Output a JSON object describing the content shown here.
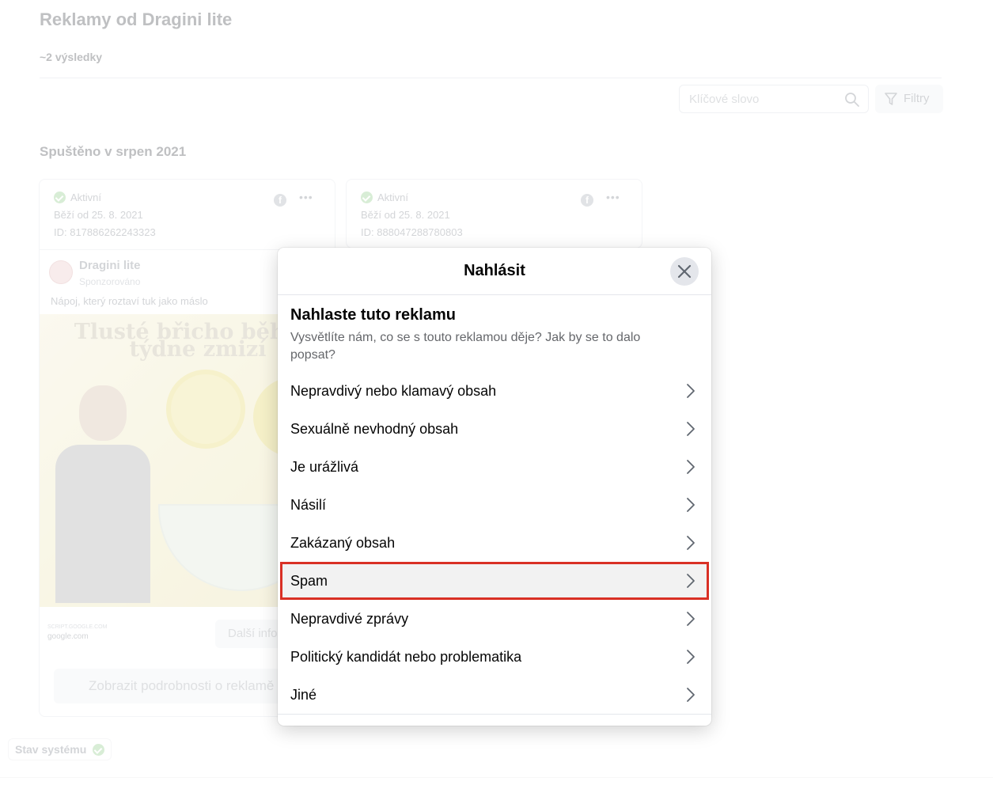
{
  "background": {
    "page_title": "Reklamy od Dragini lite",
    "result_count": "~2 výsledky",
    "search_placeholder": "Klíčové slovo",
    "filter_label": "Filtry",
    "section_title": "Spuštěno v srpen 2021",
    "cards": [
      {
        "status": "Aktivní",
        "running_since": "Běží od 25. 8. 2021",
        "id": "ID: 817886262243323",
        "advertiser": "Dragini lite",
        "sponsored": "Sponzorováno",
        "ad_text": "Nápoj, který roztaví tuk jako máslo",
        "image_headline": "Tlusté břicho během týdne zmizí",
        "domain_small": "SCRIPT.GOOGLE.COM",
        "domain": "google.com",
        "more_info": "Další informace",
        "details_button": "Zobrazit podrobnosti o reklamě"
      },
      {
        "status": "Aktivní",
        "running_since": "Běží od 25. 8. 2021",
        "id": "ID: 888047288780803"
      }
    ],
    "system_status": "Stav systému"
  },
  "modal": {
    "title": "Nahlásit",
    "heading": "Nahlaste tuto reklamu",
    "description": "Vysvětlíte nám, co se s touto reklamou děje? Jak by se to dalo popsat?",
    "options": [
      "Nepravdivý nebo klamavý obsah",
      "Sexuálně nevhodný obsah",
      "Je urážlivá",
      "Násilí",
      "Zakázaný obsah",
      "Spam",
      "Nepravdivé zprávy",
      "Politický kandidát nebo problematika",
      "Jiné"
    ],
    "highlighted_option": "Spam",
    "highlight_color": "#d93025"
  },
  "icons": {
    "close": "close-icon",
    "chevron": "chevron-right-icon",
    "search": "search-icon",
    "filter": "filter-icon",
    "facebook": "facebook-icon",
    "more": "more-icon",
    "check": "check-icon"
  }
}
